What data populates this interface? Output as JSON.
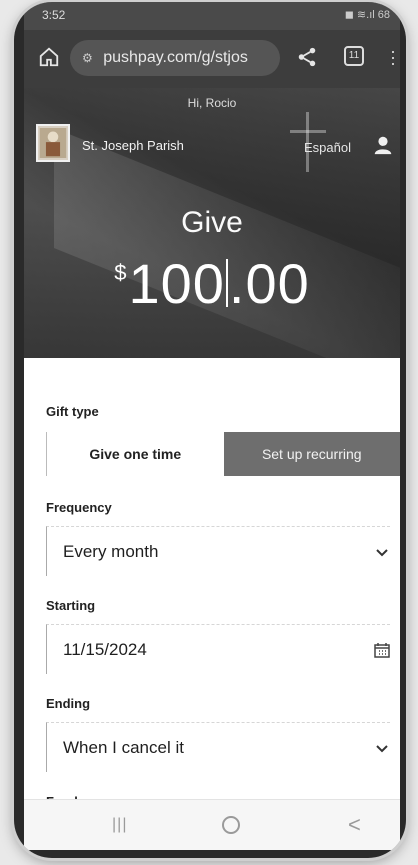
{
  "status": {
    "time": "3:52",
    "icons": "◼ ≋.ıl 68"
  },
  "browser": {
    "url": "pushpay.com/g/stjos",
    "tab_count": "11"
  },
  "hero": {
    "greeting": "Hi, Rocio",
    "parish_name": "St. Joseph Parish",
    "language_link": "Español",
    "title": "Give",
    "currency_symbol": "$",
    "amount_whole": "100",
    "amount_decimal": ".00"
  },
  "form": {
    "gift_type_label": "Gift type",
    "gift_type_options": [
      "Give one time",
      "Set up recurring"
    ],
    "frequency_label": "Frequency",
    "frequency_value": "Every month",
    "starting_label": "Starting",
    "starting_value": "11/15/2024",
    "ending_label": "Ending",
    "ending_value": "When I cancel it",
    "fund_label": "Fund"
  },
  "nav": {
    "recent": "|||",
    "back": "<"
  }
}
